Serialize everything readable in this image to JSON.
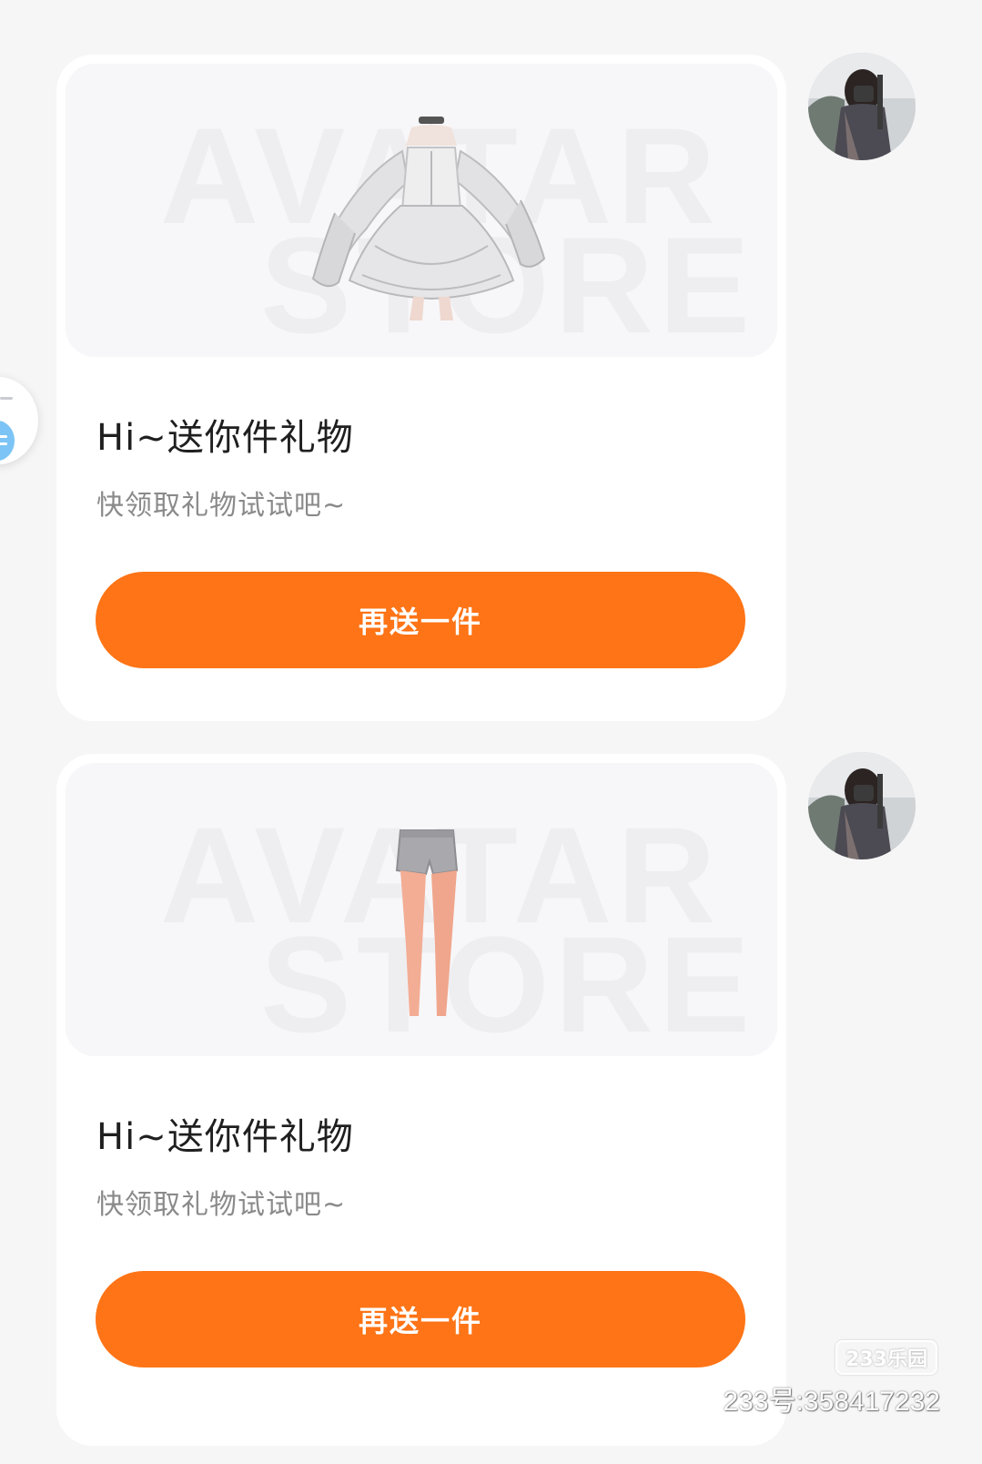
{
  "messages": [
    {
      "watermark_line1": "AVATAR",
      "watermark_line2": "STORE",
      "product_icon": "white-frilly-dress",
      "title": "Hi~送你件礼物",
      "subtitle": "快领取礼物试试吧~",
      "button_label": "再送一件",
      "avatar_icon": "user-avatar-photo"
    },
    {
      "watermark_line1": "AVATAR",
      "watermark_line2": "STORE",
      "product_icon": "grey-shorts-with-legs",
      "title": "Hi~送你件礼物",
      "subtitle": "快领取礼物试试吧~",
      "button_label": "再送一件",
      "avatar_icon": "user-avatar-photo"
    }
  ],
  "site_watermark": {
    "logo": "233乐园",
    "id_text": "233号:358417232"
  },
  "colors": {
    "accent": "#fe7416",
    "page_bg": "#f6f6f7",
    "card_bg": "#ffffff",
    "product_bg": "#f7f7f9"
  }
}
